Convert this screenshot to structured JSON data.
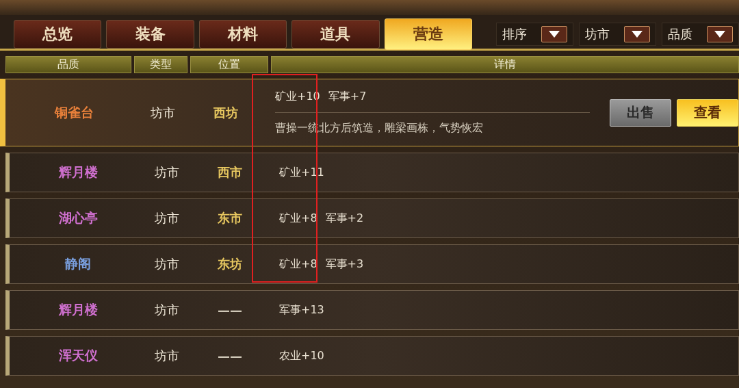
{
  "tabs": [
    {
      "label": "总览",
      "selected": false
    },
    {
      "label": "装备",
      "selected": false
    },
    {
      "label": "材料",
      "selected": false
    },
    {
      "label": "道具",
      "selected": false
    },
    {
      "label": "营造",
      "selected": true
    }
  ],
  "filters": [
    {
      "label": "排序"
    },
    {
      "label": "坊市"
    },
    {
      "label": "品质"
    }
  ],
  "table": {
    "columns": [
      "品质",
      "类型",
      "位置",
      "详情"
    ],
    "rows": [
      {
        "name": "铜雀台",
        "color": "#e8803a",
        "type": "坊市",
        "location": {
          "text": "西坊",
          "color": "#e8c860"
        },
        "bonuses": [
          "矿业+10",
          "军事+7"
        ],
        "description": "曹操一统北方后筑造，雕梁画栋，气势恢宏",
        "selected": true,
        "buttons": [
          {
            "label": "出售",
            "kind": "secondary"
          },
          {
            "label": "查看",
            "kind": "primary"
          }
        ]
      },
      {
        "name": "辉月楼",
        "color": "#d070d0",
        "type": "坊市",
        "location": {
          "text": "西市",
          "color": "#e8c860"
        },
        "bonuses": [
          "矿业+11"
        ],
        "selected": false
      },
      {
        "name": "湖心亭",
        "color": "#d070d0",
        "type": "坊市",
        "location": {
          "text": "东市",
          "color": "#e8c860"
        },
        "bonuses": [
          "矿业+8",
          "军事+2"
        ],
        "selected": false
      },
      {
        "name": "静阁",
        "color": "#7aa0e0",
        "type": "坊市",
        "location": {
          "text": "东坊",
          "color": "#e8c860"
        },
        "bonuses": [
          "矿业+8",
          "军事+3"
        ],
        "selected": false
      },
      {
        "name": "辉月楼",
        "color": "#d070d0",
        "type": "坊市",
        "location": {
          "text": "——",
          "color": "#d0c8b8"
        },
        "bonuses": [
          "军事+13"
        ],
        "selected": false
      },
      {
        "name": "浑天仪",
        "color": "#d070d0",
        "type": "坊市",
        "location": {
          "text": "——",
          "color": "#d0c8b8"
        },
        "bonuses": [
          "农业+10"
        ],
        "selected": false
      }
    ]
  }
}
